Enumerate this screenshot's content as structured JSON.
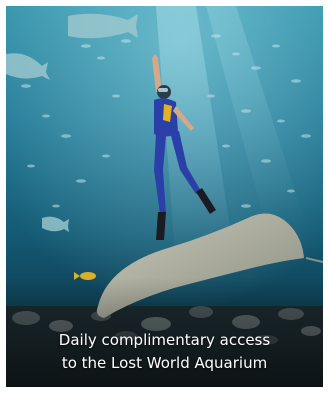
{
  "promo_card": {
    "image_subject": "diver-with-stingray-underwater",
    "caption_line1": "Daily complimentary access",
    "caption_line2": "to the Lost World Aquarium"
  },
  "colors": {
    "water_light": "#2e8ea6",
    "water_deep": "#0c3a4c",
    "caption_text": "#ffffff"
  }
}
